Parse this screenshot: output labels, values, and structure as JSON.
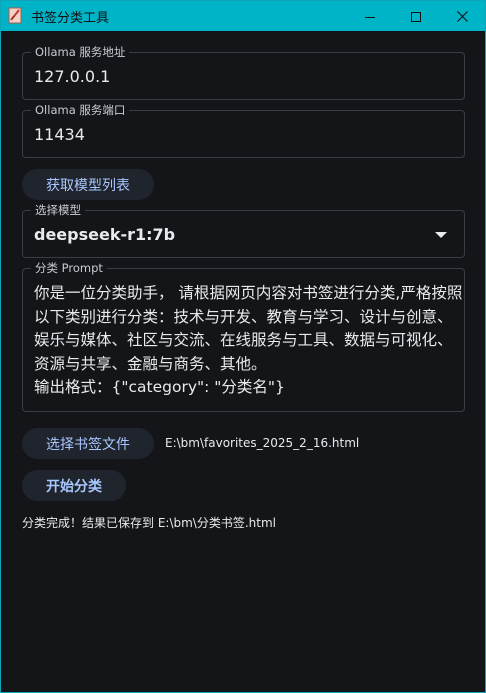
{
  "window": {
    "title": "书签分类工具",
    "icon": "app-feather-icon",
    "controls": [
      "minimize-icon",
      "maximize-icon",
      "close-icon"
    ]
  },
  "host": {
    "label": "Ollama 服务地址",
    "value": "127.0.0.1"
  },
  "port": {
    "label": "Ollama 服务端口",
    "value": "11434"
  },
  "fetch_models_button": "获取模型列表",
  "model": {
    "label": "选择模型",
    "selected": "deepseek-r1:7b"
  },
  "prompt": {
    "label": "分类 Prompt",
    "text": "你是一位分类助手， 请根据网页内容对书签进行分类,严格按照以下类别进行分类：技术与开发、教育与学习、设计与创意、娱乐与媒体、社区与交流、在线服务与工具、数据与可视化、资源与共享、金融与商务、其他。\n输出格式：{\"category\": \"分类名\"}"
  },
  "choose_file_button": "选择书签文件",
  "selected_file": "E:\\bm\\favorites_2025_2_16.html",
  "start_button": "开始分类",
  "status": "分类完成！结果已保存到 E:\\bm\\分类书签.html",
  "colors": {
    "titlebar": "#00b4c8",
    "background": "#131519",
    "button_bg": "#1f242d",
    "button_text": "#a9c7ff",
    "field_border": "#3a3e44"
  }
}
